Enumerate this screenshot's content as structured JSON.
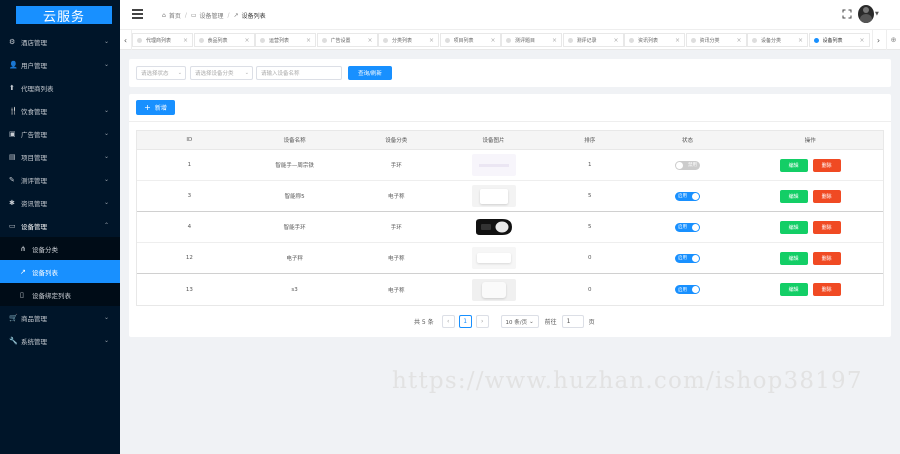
{
  "app": {
    "logo_text": "云服务"
  },
  "sidebar": {
    "items": [
      {
        "label": "酒店管理",
        "icon": "gear-icon",
        "glyph": "⚙"
      },
      {
        "label": "用户管理",
        "icon": "user-icon",
        "glyph": "👤"
      },
      {
        "label": "代理商列表",
        "icon": "agent-icon",
        "glyph": "⬆"
      },
      {
        "label": "饮食管理",
        "icon": "food-icon",
        "glyph": "🍴"
      },
      {
        "label": "广告管理",
        "icon": "ad-icon",
        "glyph": "▣"
      },
      {
        "label": "项目管理",
        "icon": "project-icon",
        "glyph": "▤"
      },
      {
        "label": "测评管理",
        "icon": "pen-icon",
        "glyph": "✎"
      },
      {
        "label": "资讯管理",
        "icon": "news-icon",
        "glyph": "✱"
      },
      {
        "label": "设备管理",
        "icon": "device-icon",
        "glyph": "▭",
        "open": true
      },
      {
        "label": "商品管理",
        "icon": "shop-icon",
        "glyph": "🛒"
      },
      {
        "label": "系统管理",
        "icon": "wrench-icon",
        "glyph": "🔧"
      }
    ],
    "device_sub": [
      {
        "label": "设备分类",
        "icon": "sitemap-icon",
        "glyph": "⋔"
      },
      {
        "label": "设备列表",
        "icon": "paper-plane-icon",
        "glyph": "↗",
        "active": true
      },
      {
        "label": "设备绑定列表",
        "icon": "mobile-icon",
        "glyph": "▯"
      }
    ]
  },
  "header": {
    "breadcrumb": [
      {
        "label": "首页",
        "icon": "home-icon",
        "glyph": "⌂"
      },
      {
        "label": "设备管理",
        "icon": "folder-icon",
        "glyph": "▭"
      },
      {
        "label": "设备列表",
        "icon": "paper-plane-icon",
        "glyph": "↗"
      }
    ]
  },
  "tabs": [
    {
      "label": "代理商列表"
    },
    {
      "label": "食品列表"
    },
    {
      "label": "运营列表"
    },
    {
      "label": "广告设置"
    },
    {
      "label": "分类列表"
    },
    {
      "label": "项目列表"
    },
    {
      "label": "测评题目"
    },
    {
      "label": "测评记录"
    },
    {
      "label": "资讯列表"
    },
    {
      "label": "资讯分类"
    },
    {
      "label": "设备分类"
    },
    {
      "label": "设备列表",
      "active": true
    }
  ],
  "search": {
    "status_placeholder": "请选择状态",
    "category_placeholder": "请选择设备分类",
    "name_placeholder": "请输入设备名称",
    "submit_label": "查询/刷新"
  },
  "toolbar": {
    "add_label": "新增"
  },
  "table": {
    "headers": [
      "ID",
      "设备名称",
      "设备分类",
      "设备图片",
      "排序",
      "状态",
      "操作"
    ],
    "rows": [
      {
        "id": "1",
        "name": "智能手—周宗铁",
        "category": "手环",
        "image": "faint",
        "sort": "1",
        "status": "禁用",
        "on": false
      },
      {
        "id": "3",
        "name": "智能称5",
        "category": "电子称",
        "image": "scale",
        "sort": "5",
        "status": "启用",
        "on": true
      },
      {
        "id": "4",
        "name": "智能手环",
        "category": "手环",
        "image": "dark",
        "sort": "5",
        "status": "启用",
        "on": true
      },
      {
        "id": "12",
        "name": "电子秤",
        "category": "电子称",
        "image": "white",
        "sort": "0",
        "status": "启用",
        "on": true
      },
      {
        "id": "13",
        "name": "s3",
        "category": "电子称",
        "image": "grey",
        "sort": "0",
        "status": "启用",
        "on": true
      }
    ],
    "edit_label": "编辑",
    "delete_label": "删除"
  },
  "pagination": {
    "total_label": "共 5 条",
    "current_page": "1",
    "page_size_label": "10 条/页",
    "goto_label": "前往",
    "goto_value": "1",
    "page_unit": "页"
  },
  "watermark": "https://www.huzhan.com/ishop38197",
  "colors": {
    "accent": "#1890ff",
    "sidebar_bg": "#001529",
    "edit": "#13ce66",
    "delete": "#f04a23"
  }
}
